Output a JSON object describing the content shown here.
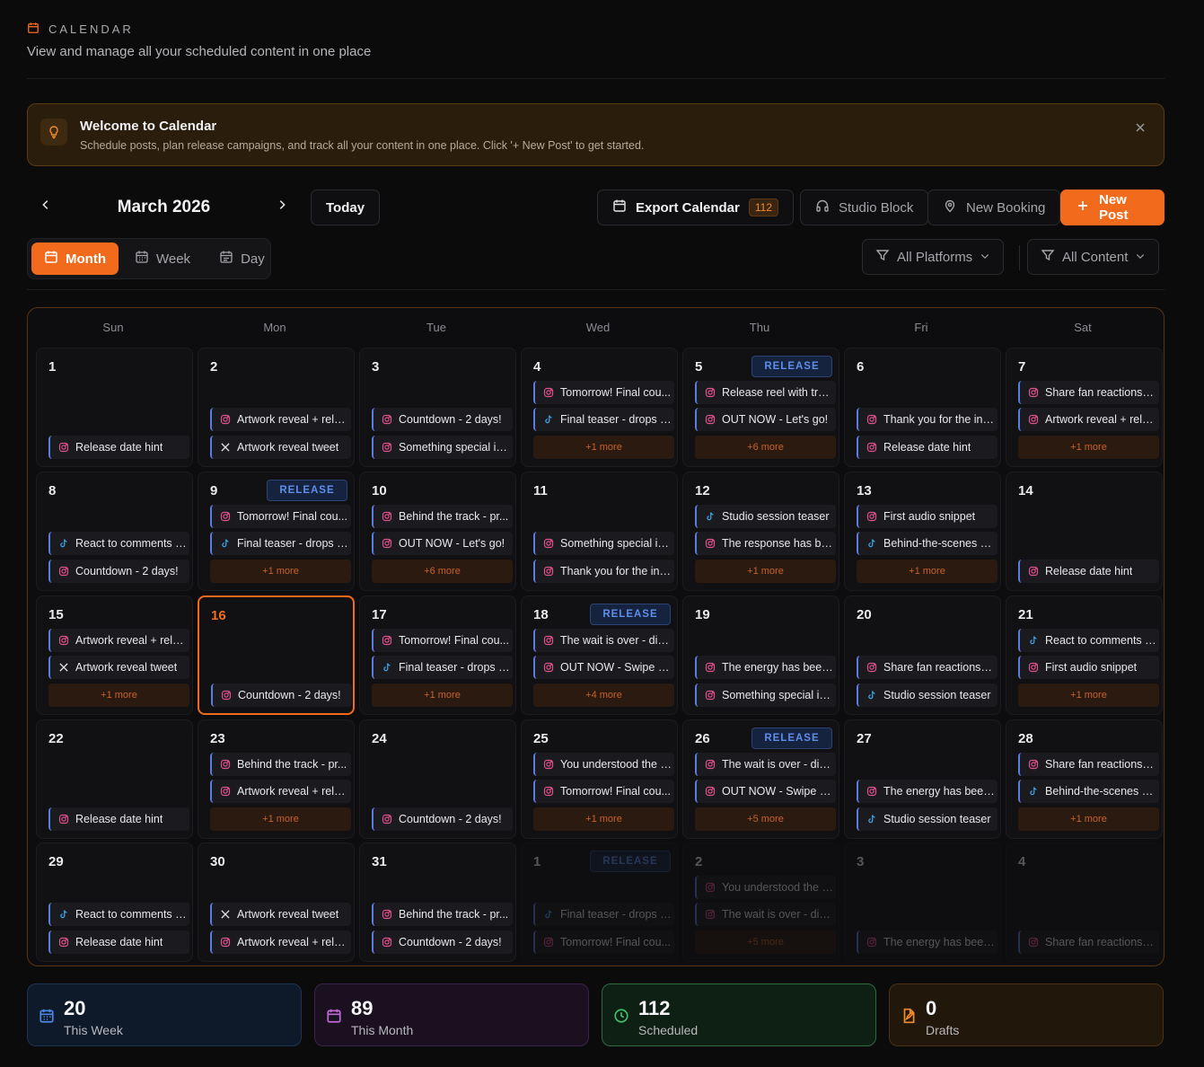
{
  "header": {
    "eyebrow": "CALENDAR",
    "subtitle": "View and manage all your scheduled content in one place"
  },
  "banner": {
    "title": "Welcome to Calendar",
    "description": "Schedule posts, plan release campaigns, and track all your content in one place. Click '+ New Post' to get started."
  },
  "toolbar": {
    "month_title": "March 2026",
    "today_label": "Today",
    "export_label": "Export Calendar",
    "export_count": "112",
    "studio_block_label": "Studio Block",
    "new_booking_label": "New Booking",
    "new_post_label": "New Post"
  },
  "views": {
    "month": "Month",
    "week": "Week",
    "day": "Day",
    "active": "month"
  },
  "filters": {
    "platforms": "All Platforms",
    "content": "All Content"
  },
  "colors": {
    "accent": "#f26b1d",
    "instagram": "#e0508e",
    "tiktok": "#3aa4e8",
    "x": "#e6e6e6",
    "release": "#5f8dea"
  },
  "weekdays": [
    "Sun",
    "Mon",
    "Tue",
    "Wed",
    "Thu",
    "Fri",
    "Sat"
  ],
  "release_label": "RELEASE",
  "weeks": [
    [
      {
        "day": "1",
        "posts": [
          {
            "p": "instagram",
            "t": "Release date hint"
          }
        ]
      },
      {
        "day": "2",
        "posts": [
          {
            "p": "instagram",
            "t": "Artwork reveal + rele..."
          },
          {
            "p": "x",
            "t": "Artwork reveal tweet"
          }
        ]
      },
      {
        "day": "3",
        "posts": [
          {
            "p": "instagram",
            "t": "Countdown - 2 days!"
          },
          {
            "p": "instagram",
            "t": "Something special is ..."
          }
        ]
      },
      {
        "day": "4",
        "posts": [
          {
            "p": "instagram",
            "t": "Tomorrow! Final cou..."
          },
          {
            "p": "tiktok",
            "t": "Final teaser - drops t..."
          }
        ],
        "more": "+1 more"
      },
      {
        "day": "5",
        "release": true,
        "posts": [
          {
            "p": "instagram",
            "t": "Release reel with tra..."
          },
          {
            "p": "instagram",
            "t": "OUT NOW - Let's go!"
          }
        ],
        "more": "+6 more"
      },
      {
        "day": "6",
        "posts": [
          {
            "p": "instagram",
            "t": "Thank you for the inc..."
          },
          {
            "p": "instagram",
            "t": "Release date hint"
          }
        ]
      },
      {
        "day": "7",
        "posts": [
          {
            "p": "instagram",
            "t": "Share fan reactions /..."
          },
          {
            "p": "instagram",
            "t": "Artwork reveal + rele..."
          }
        ],
        "more": "+1 more"
      }
    ],
    [
      {
        "day": "8",
        "posts": [
          {
            "p": "tiktok",
            "t": "React to comments /..."
          },
          {
            "p": "instagram",
            "t": "Countdown - 2 days!"
          }
        ]
      },
      {
        "day": "9",
        "release": true,
        "posts": [
          {
            "p": "instagram",
            "t": "Tomorrow! Final cou..."
          },
          {
            "p": "tiktok",
            "t": "Final teaser - drops t..."
          }
        ],
        "more": "+1 more"
      },
      {
        "day": "10",
        "posts": [
          {
            "p": "instagram",
            "t": "Behind the track - pr..."
          },
          {
            "p": "instagram",
            "t": "OUT NOW - Let's go!"
          }
        ],
        "more": "+6 more"
      },
      {
        "day": "11",
        "posts": [
          {
            "p": "instagram",
            "t": "Something special is ..."
          },
          {
            "p": "instagram",
            "t": "Thank you for the inc..."
          }
        ]
      },
      {
        "day": "12",
        "posts": [
          {
            "p": "tiktok",
            "t": "Studio session teaser"
          },
          {
            "p": "instagram",
            "t": "The response has be..."
          }
        ],
        "more": "+1 more"
      },
      {
        "day": "13",
        "posts": [
          {
            "p": "instagram",
            "t": "First audio snippet"
          },
          {
            "p": "tiktok",
            "t": "Behind-the-scenes p..."
          }
        ],
        "more": "+1 more"
      },
      {
        "day": "14",
        "posts": [
          {
            "p": "instagram",
            "t": "Release date hint"
          }
        ]
      }
    ],
    [
      {
        "day": "15",
        "posts": [
          {
            "p": "instagram",
            "t": "Artwork reveal + rele..."
          },
          {
            "p": "x",
            "t": "Artwork reveal tweet"
          }
        ],
        "more": "+1 more"
      },
      {
        "day": "16",
        "today": true,
        "posts": [
          {
            "p": "instagram",
            "t": "Countdown - 2 days!"
          }
        ]
      },
      {
        "day": "17",
        "posts": [
          {
            "p": "instagram",
            "t": "Tomorrow! Final cou..."
          },
          {
            "p": "tiktok",
            "t": "Final teaser - drops t..."
          }
        ],
        "more": "+1 more"
      },
      {
        "day": "18",
        "release": true,
        "posts": [
          {
            "p": "instagram",
            "t": "The wait is over - div..."
          },
          {
            "p": "instagram",
            "t": "OUT NOW - Swipe up!"
          }
        ],
        "more": "+4 more"
      },
      {
        "day": "19",
        "posts": [
          {
            "p": "instagram",
            "t": "The energy has been..."
          },
          {
            "p": "instagram",
            "t": "Something special is ..."
          }
        ]
      },
      {
        "day": "20",
        "posts": [
          {
            "p": "instagram",
            "t": "Share fan reactions /..."
          },
          {
            "p": "tiktok",
            "t": "Studio session teaser"
          }
        ]
      },
      {
        "day": "21",
        "posts": [
          {
            "p": "tiktok",
            "t": "React to comments /..."
          },
          {
            "p": "instagram",
            "t": "First audio snippet"
          }
        ],
        "more": "+1 more"
      }
    ],
    [
      {
        "day": "22",
        "posts": [
          {
            "p": "instagram",
            "t": "Release date hint"
          }
        ]
      },
      {
        "day": "23",
        "posts": [
          {
            "p": "instagram",
            "t": "Behind the track - pr..."
          },
          {
            "p": "instagram",
            "t": "Artwork reveal + rele..."
          }
        ],
        "more": "+1 more"
      },
      {
        "day": "24",
        "posts": [
          {
            "p": "instagram",
            "t": "Countdown - 2 days!"
          }
        ]
      },
      {
        "day": "25",
        "posts": [
          {
            "p": "instagram",
            "t": "You understood the v..."
          },
          {
            "p": "instagram",
            "t": "Tomorrow! Final cou..."
          }
        ],
        "more": "+1 more"
      },
      {
        "day": "26",
        "release": true,
        "posts": [
          {
            "p": "instagram",
            "t": "The wait is over - div..."
          },
          {
            "p": "instagram",
            "t": "OUT NOW - Swipe up!"
          }
        ],
        "more": "+5 more"
      },
      {
        "day": "27",
        "posts": [
          {
            "p": "instagram",
            "t": "The energy has been..."
          },
          {
            "p": "tiktok",
            "t": "Studio session teaser"
          }
        ]
      },
      {
        "day": "28",
        "posts": [
          {
            "p": "instagram",
            "t": "Share fan reactions /..."
          },
          {
            "p": "tiktok",
            "t": "Behind-the-scenes p..."
          }
        ],
        "more": "+1 more"
      }
    ],
    [
      {
        "day": "29",
        "posts": [
          {
            "p": "tiktok",
            "t": "React to comments /..."
          },
          {
            "p": "instagram",
            "t": "Release date hint"
          }
        ]
      },
      {
        "day": "30",
        "posts": [
          {
            "p": "x",
            "t": "Artwork reveal tweet"
          },
          {
            "p": "instagram",
            "t": "Artwork reveal + rele..."
          }
        ]
      },
      {
        "day": "31",
        "posts": [
          {
            "p": "instagram",
            "t": "Behind the track - pr..."
          },
          {
            "p": "instagram",
            "t": "Countdown - 2 days!"
          }
        ]
      },
      {
        "day": "1",
        "dim": true,
        "release": true,
        "posts": [
          {
            "p": "tiktok",
            "t": "Final teaser - drops t..."
          },
          {
            "p": "instagram",
            "t": "Tomorrow! Final cou..."
          }
        ]
      },
      {
        "day": "2",
        "dim": true,
        "posts": [
          {
            "p": "instagram",
            "t": "You understood the v..."
          },
          {
            "p": "instagram",
            "t": "The wait is over - div..."
          }
        ],
        "more": "+5 more"
      },
      {
        "day": "3",
        "dim": true,
        "posts": [
          {
            "p": "instagram",
            "t": "The energy has been..."
          }
        ]
      },
      {
        "day": "4",
        "dim": true,
        "posts": [
          {
            "p": "instagram",
            "t": "Share fan reactions /..."
          }
        ]
      }
    ]
  ],
  "stats": [
    {
      "value": "20",
      "label": "This Week",
      "icon": "calendar-icon"
    },
    {
      "value": "89",
      "label": "This Month",
      "icon": "calendar-icon"
    },
    {
      "value": "112",
      "label": "Scheduled",
      "icon": "clock-icon"
    },
    {
      "value": "0",
      "label": "Drafts",
      "icon": "draft-icon"
    }
  ]
}
